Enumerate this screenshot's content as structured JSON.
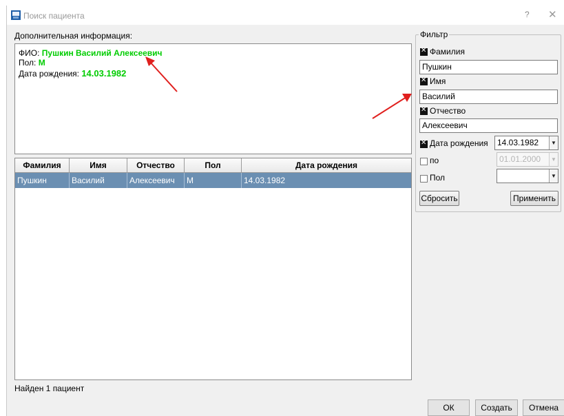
{
  "window": {
    "title": "Поиск пациента",
    "help_glyph": "?",
    "close_glyph": "✕"
  },
  "info": {
    "label": "Дополнительная информация:",
    "fio_label": "ФИО:",
    "fio_value": "Пушкин Василий Алексеевич",
    "sex_label": "Пол:",
    "sex_value": "М",
    "dob_label": "Дата рождения:",
    "dob_value": "14.03.1982"
  },
  "table": {
    "columns": [
      "Фамилия",
      "Имя",
      "Отчество",
      "Пол",
      "Дата рождения"
    ],
    "rows": [
      [
        "Пушкин",
        "Василий",
        "Алексеевич",
        "М",
        "14.03.1982"
      ]
    ],
    "selected_row": 0,
    "selected_color": "#6b8fb2"
  },
  "status": "Найден 1 пациент",
  "filter": {
    "title": "Фильтр",
    "surname": {
      "label": "Фамилия",
      "checked": true,
      "value": "Пушкин"
    },
    "name": {
      "label": "Имя",
      "checked": true,
      "value": "Василий"
    },
    "patronymic": {
      "label": "Отчество",
      "checked": true,
      "value": "Алексеевич"
    },
    "dob": {
      "label": "Дата рождения",
      "checked": true,
      "value": "14.03.1982"
    },
    "to": {
      "label": "по",
      "checked": false,
      "value": "01.01.2000"
    },
    "sex": {
      "label": "Пол",
      "checked": false,
      "value": ""
    },
    "reset_label": "Сбросить",
    "apply_label": "Применить"
  },
  "buttons": {
    "ok": "ОК",
    "create": "Создать",
    "cancel": "Отмена"
  },
  "colors": {
    "highlight_green": "#00cc00",
    "annotation_arrow": "#e0201e"
  }
}
